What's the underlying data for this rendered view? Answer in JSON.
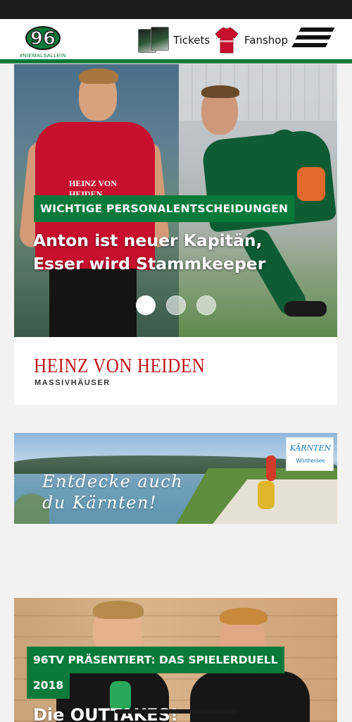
{
  "header": {
    "logo_number": "96",
    "logo_tagline": "#NIEMALSALLEIN",
    "nav": [
      {
        "label": "Tickets",
        "icon": "tickets-icon"
      },
      {
        "label": "Fanshop",
        "icon": "jersey-icon"
      }
    ],
    "menu_icon": "hamburger-menu-icon"
  },
  "hero": {
    "tag": "WICHTIGE PERSONALENTSCHEIDUNGEN",
    "headline_line1": "Anton ist neuer Kapitän,",
    "headline_line2": "Esser wird Stammkeeper",
    "left_jersey_sponsor": "HEINZ VON HEIDEN",
    "slides_total": 3,
    "active_slide": 1
  },
  "sponsor": {
    "name": "HEINZ VON HEIDEN",
    "subline": "MASSIVHÄUSER"
  },
  "ad": {
    "text_line1": "Entdecke auch",
    "text_line2": "du Kärnten!",
    "logo_main": "KÄRNTEN",
    "logo_sub": "Wörthersee"
  },
  "teaser": {
    "tag_line1": "96TV PRÄSENTIERT: DAS SPIELERDUELL",
    "tag_line2": "2018",
    "headline": "Die OUTTAKES!"
  },
  "colors": {
    "brand_green": "#0a7a3a",
    "sponsor_red": "#c0141c",
    "status_bar": "#1c1c1c"
  }
}
